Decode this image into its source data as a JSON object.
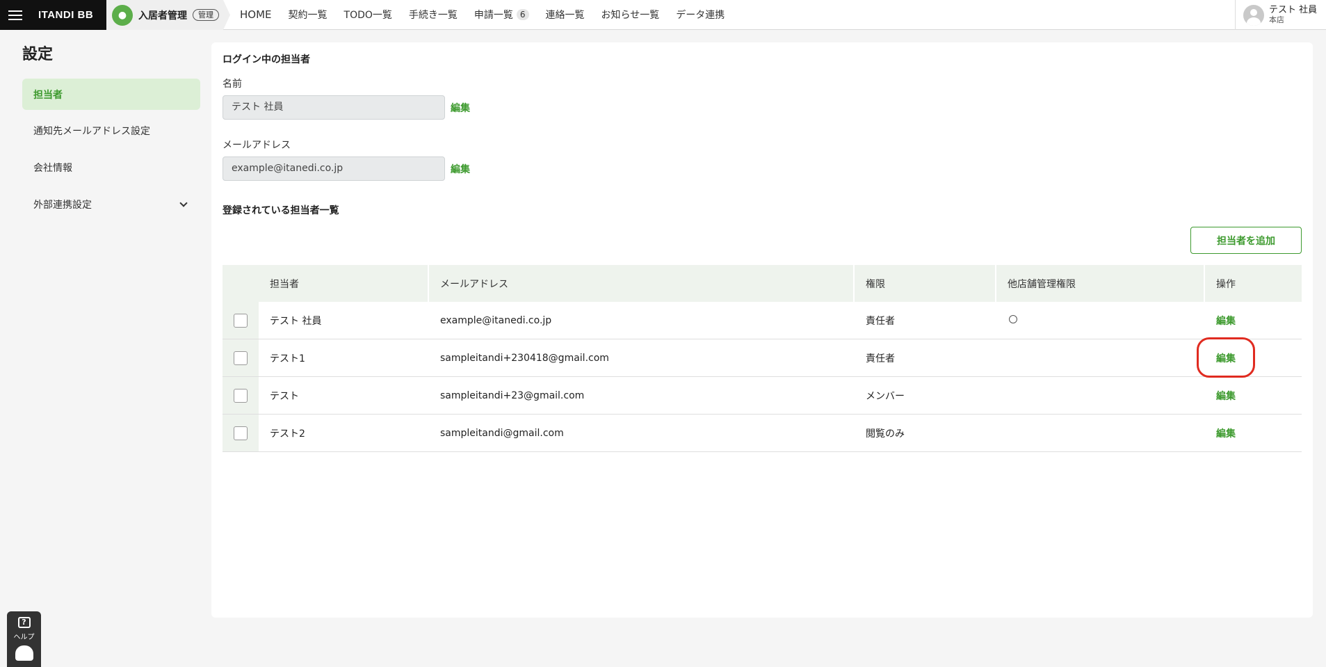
{
  "header": {
    "brand": "ITANDI BB",
    "app_name": "入居者管理",
    "app_tag": "管理",
    "nav": [
      {
        "label": "HOME"
      },
      {
        "label": "契約一覧"
      },
      {
        "label": "TODO一覧"
      },
      {
        "label": "手続き一覧"
      },
      {
        "label": "申請一覧",
        "badge": "6"
      },
      {
        "label": "連絡一覧"
      },
      {
        "label": "お知らせ一覧"
      },
      {
        "label": "データ連携"
      }
    ],
    "user_name": "テスト 社員",
    "user_store": "本店"
  },
  "sidebar": {
    "title": "設定",
    "items": [
      {
        "label": "担当者",
        "active": true
      },
      {
        "label": "通知先メールアドレス設定"
      },
      {
        "label": "会社情報"
      },
      {
        "label": "外部連携設定"
      }
    ]
  },
  "help": {
    "label": "ヘルプ",
    "icon": "?"
  },
  "main": {
    "login_section_title": "ログイン中の担当者",
    "name_label": "名前",
    "name_value": "テスト 社員",
    "email_label": "メールアドレス",
    "email_value": "example@itanedi.co.jp",
    "edit_label": "編集",
    "list_title": "登録されている担当者一覧",
    "add_button": "担当者を追加",
    "table": {
      "headers": [
        "担当者",
        "メールアドレス",
        "権限",
        "他店舗管理権限",
        "操作"
      ],
      "rows": [
        {
          "name": "テスト 社員",
          "email": "example@itanedi.co.jp",
          "role": "責任者",
          "other_store": "○",
          "action": "編集"
        },
        {
          "name": "テスト1",
          "email": "sampleitandi+230418@gmail.com",
          "role": "責任者",
          "other_store": "",
          "action": "編集"
        },
        {
          "name": "テスト",
          "email": "sampleitandi+23@gmail.com",
          "role": "メンバー",
          "other_store": "",
          "action": "編集"
        },
        {
          "name": "テスト2",
          "email": "sampleitandi@gmail.com",
          "role": "閲覧のみ",
          "other_store": "",
          "action": "編集"
        }
      ]
    }
  },
  "colors": {
    "accent": "#3d9a2e",
    "highlight": "#e02b20"
  }
}
